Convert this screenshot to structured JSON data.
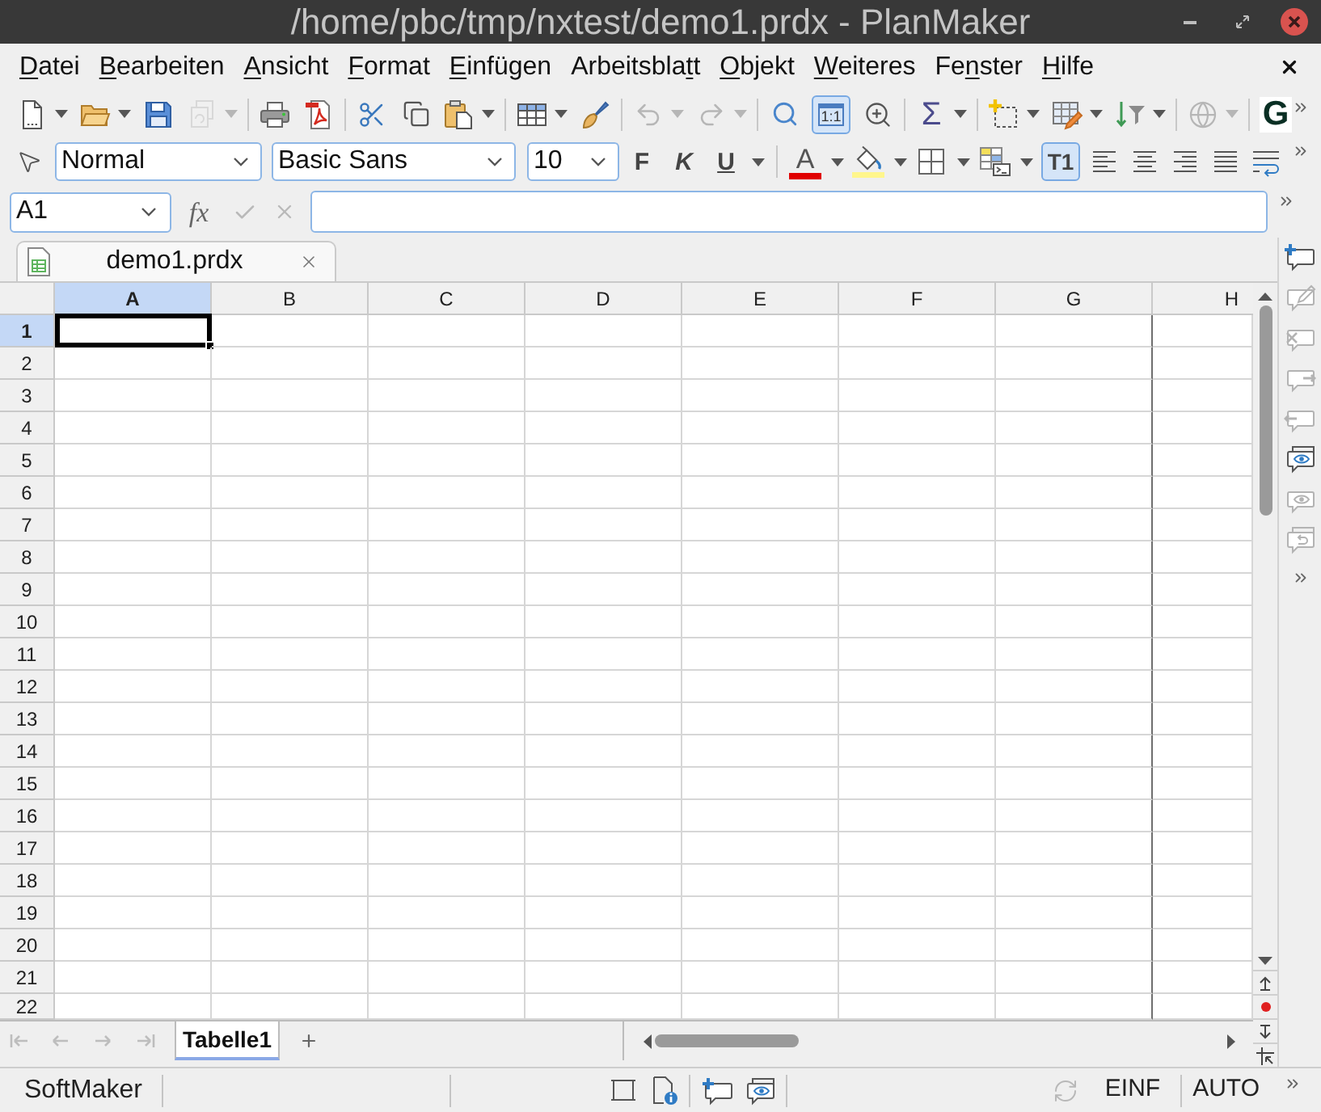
{
  "window": {
    "title": "/home/pbc/tmp/nxtest/demo1.prdx - PlanMaker"
  },
  "menu": [
    {
      "key": "D",
      "after": "atei"
    },
    {
      "key": "B",
      "after": "earbeiten"
    },
    {
      "key": "A",
      "after": "nsicht"
    },
    {
      "key": "F",
      "after": "ormat"
    },
    {
      "key": "E",
      "after": "infügen"
    },
    {
      "before": "Arbeitsbla",
      "key": "t",
      "after": "t"
    },
    {
      "key": "O",
      "after": "bjekt"
    },
    {
      "key": "W",
      "after": "eiteres"
    },
    {
      "before": "Fe",
      "key": "n",
      "after": "ster"
    },
    {
      "key": "H",
      "after": "ilfe"
    }
  ],
  "standard_toolbar": [
    [
      {
        "kind": "new",
        "dropdown": true,
        "disabled": false,
        "pressed": false
      },
      {
        "kind": "open",
        "dropdown": true,
        "disabled": false,
        "pressed": false
      },
      {
        "kind": "save",
        "dropdown": false,
        "disabled": false,
        "pressed": false
      },
      {
        "kind": "save_all",
        "dropdown": true,
        "disabled": true,
        "pressed": false
      }
    ],
    [
      {
        "kind": "print",
        "dropdown": false,
        "disabled": false,
        "pressed": false
      },
      {
        "kind": "pdf",
        "dropdown": false,
        "disabled": false,
        "pressed": false
      }
    ],
    [
      {
        "kind": "cut",
        "dropdown": false,
        "disabled": false,
        "pressed": false
      },
      {
        "kind": "copy",
        "dropdown": false,
        "disabled": false,
        "pressed": false
      },
      {
        "kind": "paste",
        "dropdown": true,
        "disabled": false,
        "pressed": false
      }
    ],
    [
      {
        "kind": "cell_grid",
        "dropdown": true,
        "disabled": false,
        "pressed": false
      },
      {
        "kind": "brush",
        "dropdown": false,
        "disabled": false,
        "pressed": false
      }
    ],
    [
      {
        "kind": "undo",
        "dropdown": true,
        "disabled": true,
        "pressed": false
      },
      {
        "kind": "redo",
        "dropdown": true,
        "disabled": true,
        "pressed": false
      }
    ],
    [
      {
        "kind": "search",
        "dropdown": false,
        "disabled": false,
        "pressed": false
      },
      {
        "kind": "zoom_actual",
        "glyph": "1:1",
        "dropdown": false,
        "disabled": false,
        "pressed": true
      },
      {
        "kind": "zoom_page",
        "dropdown": false,
        "disabled": false,
        "pressed": false
      }
    ],
    [
      {
        "kind": "sum",
        "glyph": "Σ",
        "dropdown": true,
        "disabled": false,
        "pressed": false
      }
    ],
    [
      {
        "kind": "frame",
        "dropdown": true,
        "disabled": false,
        "pressed": false
      },
      {
        "kind": "table_style",
        "dropdown": true,
        "disabled": false,
        "pressed": false
      },
      {
        "kind": "sort",
        "dropdown": true,
        "disabled": false,
        "pressed": false
      }
    ],
    [
      {
        "kind": "globe",
        "dropdown": true,
        "disabled": true,
        "pressed": false
      }
    ],
    [
      {
        "kind": "logo",
        "glyph": "G",
        "dropdown": false,
        "disabled": false,
        "pressed": false
      }
    ]
  ],
  "format_toolbar": {
    "style_box": {
      "value": "Normal"
    },
    "font_box": {
      "value": "Basic Sans"
    },
    "size_box": {
      "value": "10"
    },
    "groups": [
      [
        {
          "kind": "bold",
          "glyph": "F",
          "dropdown": false,
          "disabled": false,
          "pressed": false
        },
        {
          "kind": "italic",
          "glyph": "K",
          "dropdown": false,
          "disabled": false,
          "pressed": false
        },
        {
          "kind": "underline",
          "glyph": "U",
          "dropdown": true,
          "disabled": false,
          "pressed": false
        }
      ],
      [
        {
          "kind": "font_color",
          "glyph": "A",
          "dropdown": true,
          "disabled": false,
          "pressed": false
        },
        {
          "kind": "fill",
          "dropdown": true,
          "disabled": false,
          "pressed": false
        },
        {
          "kind": "borders",
          "dropdown": true,
          "disabled": false,
          "pressed": false
        },
        {
          "kind": "cell_style",
          "dropdown": true,
          "disabled": false,
          "pressed": false
        },
        {
          "kind": "text_frame",
          "glyph": "T1",
          "dropdown": false,
          "disabled": false,
          "pressed": true
        },
        {
          "kind": "align_left",
          "dropdown": false,
          "disabled": false,
          "pressed": false
        },
        {
          "kind": "align_center",
          "dropdown": false,
          "disabled": false,
          "pressed": false
        },
        {
          "kind": "align_right",
          "dropdown": false,
          "disabled": false,
          "pressed": false
        },
        {
          "kind": "justify",
          "dropdown": false,
          "disabled": false,
          "pressed": false
        },
        {
          "kind": "wrap",
          "dropdown": false,
          "disabled": false,
          "pressed": false
        }
      ]
    ]
  },
  "formula_bar": {
    "name_box": {
      "value": "A1"
    },
    "function_button": "fx",
    "buttons": [
      {
        "kind": "confirm",
        "disabled": true
      },
      {
        "kind": "cancel",
        "disabled": true
      }
    ]
  },
  "document_tabs": [
    {
      "label": "demo1.prdx",
      "selected": true
    }
  ],
  "sheet": {
    "columns": [
      {
        "label": "A",
        "selected": true,
        "page_break": false
      },
      {
        "label": "B",
        "selected": false,
        "page_break": false
      },
      {
        "label": "C",
        "selected": false,
        "page_break": false
      },
      {
        "label": "D",
        "selected": false,
        "page_break": false
      },
      {
        "label": "E",
        "selected": false,
        "page_break": false
      },
      {
        "label": "F",
        "selected": false,
        "page_break": false
      },
      {
        "label": "G",
        "selected": false,
        "page_break": true
      },
      {
        "label": "H",
        "selected": false,
        "page_break": false
      }
    ],
    "rows": [
      {
        "label": "1",
        "selected": true
      },
      {
        "label": "2",
        "selected": false
      },
      {
        "label": "3",
        "selected": false
      },
      {
        "label": "4",
        "selected": false
      },
      {
        "label": "5",
        "selected": false
      },
      {
        "label": "6",
        "selected": false
      },
      {
        "label": "7",
        "selected": false
      },
      {
        "label": "8",
        "selected": false
      },
      {
        "label": "9",
        "selected": false
      },
      {
        "label": "10",
        "selected": false
      },
      {
        "label": "11",
        "selected": false
      },
      {
        "label": "12",
        "selected": false
      },
      {
        "label": "13",
        "selected": false
      },
      {
        "label": "14",
        "selected": false
      },
      {
        "label": "15",
        "selected": false
      },
      {
        "label": "16",
        "selected": false
      },
      {
        "label": "17",
        "selected": false
      },
      {
        "label": "18",
        "selected": false
      },
      {
        "label": "19",
        "selected": false
      },
      {
        "label": "20",
        "selected": false
      },
      {
        "label": "21",
        "selected": false
      },
      {
        "label": "22",
        "selected": false
      }
    ]
  },
  "comment_tools": [
    {
      "kind": "add",
      "disabled": false
    },
    {
      "kind": "edit",
      "disabled": true
    },
    {
      "kind": "delete",
      "disabled": true
    },
    {
      "kind": "next",
      "disabled": true
    },
    {
      "kind": "previous",
      "disabled": true
    },
    {
      "kind": "show_all",
      "disabled": false
    },
    {
      "kind": "show",
      "disabled": true
    },
    {
      "kind": "revert",
      "disabled": true
    }
  ],
  "sheet_navigation": [
    {
      "kind": "first",
      "disabled": true
    },
    {
      "kind": "previous",
      "disabled": true
    },
    {
      "kind": "next",
      "disabled": true
    },
    {
      "kind": "last",
      "disabled": true
    }
  ],
  "sheet_tabs": [
    {
      "label": "Tabelle1",
      "selected": true
    }
  ],
  "status_bar": {
    "brand": "SoftMaker",
    "insert_mode": "EINF",
    "calc_mode": "AUTO"
  }
}
